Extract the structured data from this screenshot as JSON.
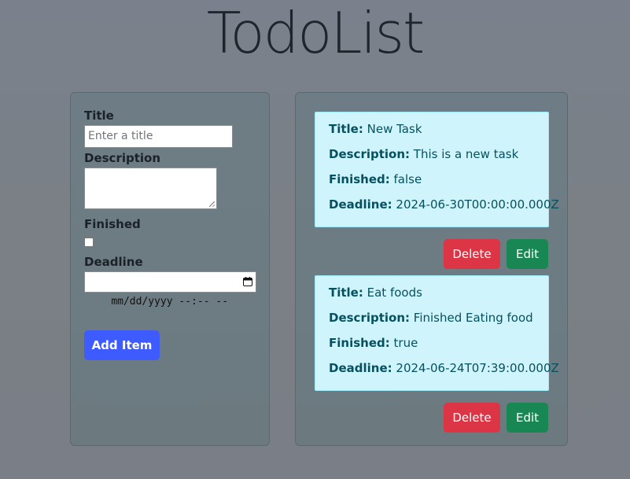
{
  "app": {
    "title": "TodoList"
  },
  "form": {
    "title_label": "Title",
    "title_placeholder": "Enter a title",
    "description_label": "Description",
    "finished_label": "Finished",
    "deadline_label": "Deadline",
    "deadline_placeholder": "mm/dd/yyyy --:-- --",
    "finished_checked": false,
    "add_button": "Add Item"
  },
  "todos": [
    {
      "title_key": "Title:",
      "title": "New Task",
      "description_key": "Description:",
      "description": "This is a new task",
      "finished_key": "Finished:",
      "finished": "false",
      "deadline_key": "Deadline:",
      "deadline": "2024-06-30T00:00:00.000Z",
      "delete_label": "Delete",
      "edit_label": "Edit"
    },
    {
      "title_key": "Title:",
      "title": "Eat foods",
      "description_key": "Description:",
      "description": "Finished Eating food",
      "finished_key": "Finished:",
      "finished": "true",
      "deadline_key": "Deadline:",
      "deadline": "2024-06-24T07:39:00.000Z",
      "delete_label": "Delete",
      "edit_label": "Edit"
    }
  ],
  "colors": {
    "add_button": "#3d5bff",
    "delete_button": "#dc3545",
    "edit_button": "#198754",
    "card_background": "#cff4fc",
    "card_text": "#055160"
  },
  "icons": {
    "deadline_picker": "calendar-icon"
  }
}
